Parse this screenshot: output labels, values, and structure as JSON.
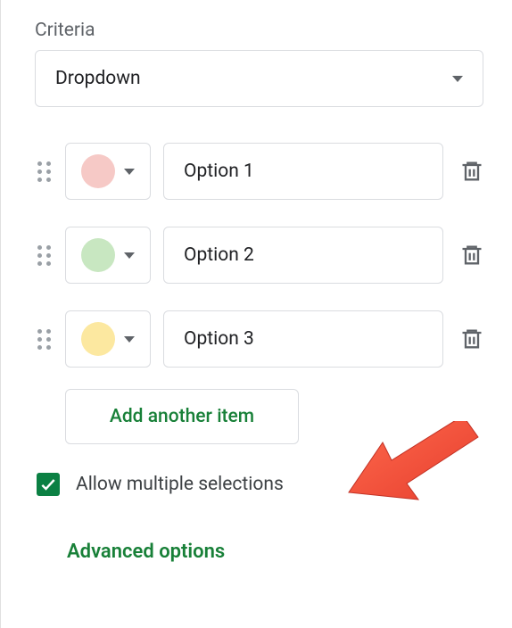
{
  "criteria": {
    "label": "Criteria",
    "selected": "Dropdown"
  },
  "options": [
    {
      "color": "#f6c9c6",
      "value": "Option 1"
    },
    {
      "color": "#c8e7c1",
      "value": "Option 2"
    },
    {
      "color": "#fce8a0",
      "value": "Option 3"
    }
  ],
  "add_item_label": "Add another item",
  "allow_multiple": {
    "checked": true,
    "label": "Allow multiple selections"
  },
  "advanced_label": "Advanced options"
}
